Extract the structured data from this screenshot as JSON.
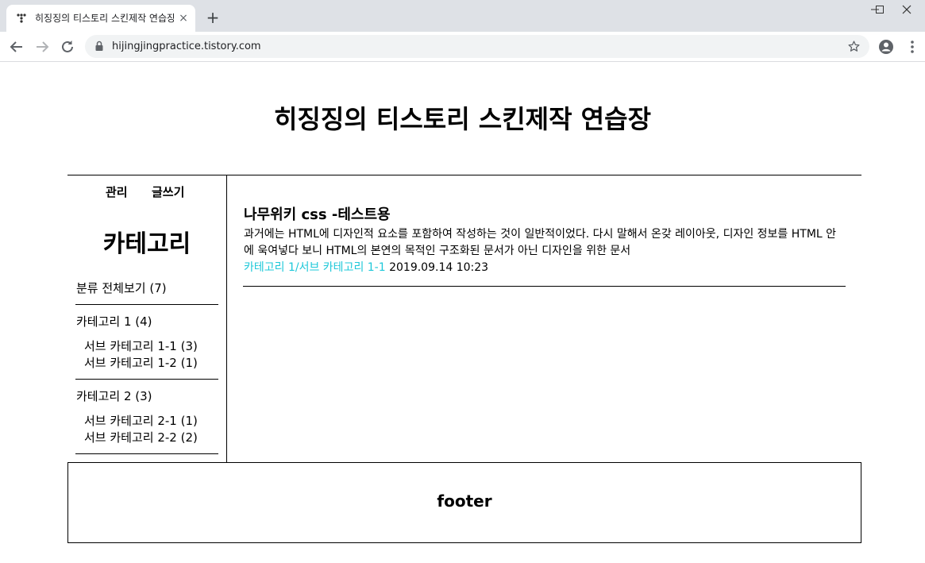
{
  "browser": {
    "tab_title": "히징징의 티스토리 스킨제작 연습장",
    "tab_close": "×",
    "new_tab": "+",
    "url": "hijingjingpractice.tistory.com"
  },
  "blog": {
    "title": "히징징의 티스토리 스킨제작 연습장"
  },
  "sidebar": {
    "admin_label": "관리",
    "write_label": "글쓰기",
    "category_heading": "카테고리",
    "all_posts": "분류 전체보기 (7)",
    "categories": [
      {
        "label": "카테고리 1 (4)",
        "subs": [
          "서브 카테고리 1-1 (3)",
          "서브 카테고리 1-2 (1)"
        ]
      },
      {
        "label": "카테고리 2 (3)",
        "subs": [
          "서브 카테고리 2-1 (1)",
          "서브 카테고리 2-2 (2)"
        ]
      }
    ]
  },
  "post": {
    "title": "나무위키 css -테스트용",
    "excerpt": "과거에는 HTML에 디자인적 요소를 포함하여 작성하는 것이 일반적이었다. 다시 말해서 온갖 레이아웃, 디자인 정보를 HTML 안에 욱여넣다 보니 HTML의 본연의 목적인 구조화된 문서가 아닌 디자인을 위한 문서",
    "category": "카테고리 1/서브 카테고리 1-1",
    "date": "2019.09.14 10:23"
  },
  "footer": {
    "text": "footer"
  },
  "colors": {
    "category_link": "#1ec8d9",
    "chrome_bg": "#dee1e6",
    "omnibox_bg": "#f1f3f4"
  },
  "icons": [
    "tistory-favicon",
    "back-arrow-icon",
    "forward-arrow-icon",
    "reload-icon",
    "lock-icon",
    "star-icon",
    "profile-icon",
    "menu-dots-icon"
  ]
}
